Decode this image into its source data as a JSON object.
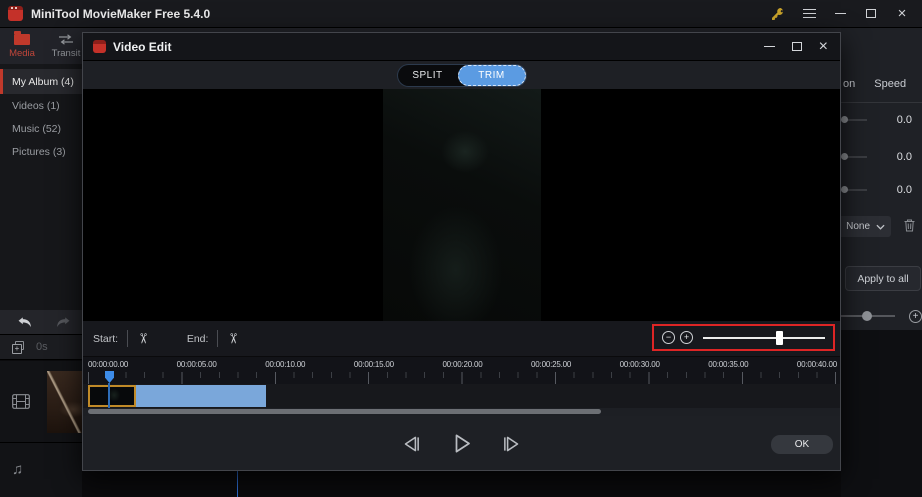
{
  "titlebar": {
    "title": "MiniTool MovieMaker Free 5.4.0"
  },
  "toolbar": {
    "media_label": "Media",
    "transition_label": "Transit"
  },
  "sidebar": {
    "items": [
      {
        "label": "My Album (4)",
        "selected": true
      },
      {
        "label": "Videos (1)",
        "selected": false
      },
      {
        "label": "Music (52)",
        "selected": false
      },
      {
        "label": "Pictures (3)",
        "selected": false
      }
    ]
  },
  "right_panel": {
    "tab_motion": "on",
    "tab_speed": "Speed",
    "slider_values": [
      "0.0",
      "0.0",
      "0.0"
    ],
    "dropdown_value": "None",
    "apply_label": "Apply to all"
  },
  "tracks": {
    "duration_label": "0s"
  },
  "dialog": {
    "title": "Video Edit",
    "split_label": "SPLIT",
    "trim_label": "TRIM",
    "active_mode": "TRIM",
    "start_label": "Start:",
    "end_label": "End:",
    "ok_label": "OK",
    "ruler_labels": [
      "00:00:00.00",
      "00:00:05.00",
      "00:00:10.00",
      "00:00:15.00",
      "00:00:20.00",
      "00:00:25.00",
      "00:00:30.00",
      "00:00:35.00",
      "00:00:40.00"
    ]
  },
  "icons": {
    "close": "×",
    "minus": "−",
    "plus": "+",
    "scissors": "✂",
    "music_note": "♫"
  },
  "colors": {
    "accent_blue": "#5b9be2",
    "highlight_red": "#de2525",
    "clip_blue": "#7aa7da",
    "selected_red": "#c0392b",
    "key_gold": "#c8a22a",
    "playhead_blue": "#3d8ce8"
  }
}
